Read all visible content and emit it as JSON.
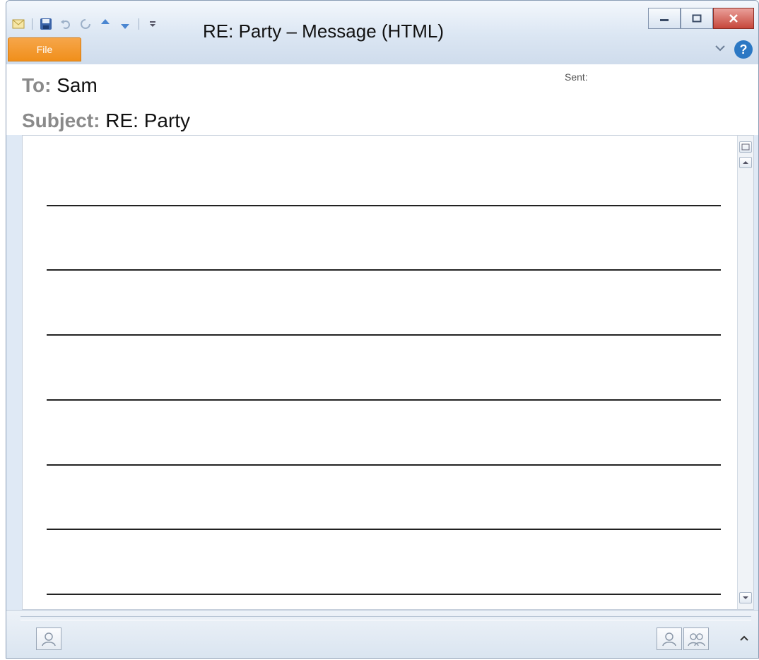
{
  "window": {
    "title": "RE: Party – Message (HTML)",
    "file_tab_label": "File"
  },
  "header": {
    "to_label": "To:",
    "to_value": "Sam",
    "subject_label": "Subject:",
    "subject_value": "RE: Party",
    "sent_label": "Sent:"
  },
  "body": {
    "blank_lines": 7
  },
  "icons": {
    "qat": [
      "mail-icon",
      "save-icon",
      "undo-icon",
      "redo-icon",
      "previous-item-icon",
      "next-item-icon",
      "customize-qat-icon"
    ],
    "window_controls": [
      "minimize-icon",
      "maximize-icon",
      "close-icon"
    ],
    "ribbon": [
      "ribbon-collapse-icon",
      "help-icon"
    ]
  },
  "colors": {
    "file_tab": "#f08f1b",
    "help": "#2c78c4",
    "label_gray": "#8a8a8a"
  }
}
